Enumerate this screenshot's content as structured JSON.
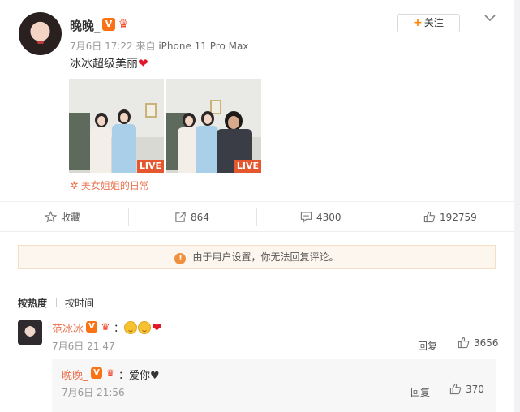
{
  "post": {
    "author": "晚晚_",
    "date": "7月6日 17:22",
    "source_prefix": "来自",
    "device": "iPhone 11 Pro Max",
    "follow_label": "关注",
    "text": "冰冰超级美丽",
    "photos": [
      {
        "tag": "LIVE"
      },
      {
        "tag": "LIVE"
      }
    ],
    "topic": "美女姐姐的日常"
  },
  "actions": {
    "favorite_label": "收藏",
    "share_count": "864",
    "comment_count": "4300",
    "like_count": "192759"
  },
  "notice": {
    "text": "由于用户设置，你无法回复评论。"
  },
  "sort": {
    "by_heat": "按热度",
    "by_time": "按时间"
  },
  "comments": [
    {
      "name": "范冰冰",
      "time": "7月6日 21:47",
      "reply_label": "回复",
      "likes": "3656",
      "replies": [
        {
          "name": "晚晚_",
          "text": "爱你♥",
          "time": "7月6日 21:56",
          "reply_label": "回复",
          "likes": "370"
        }
      ]
    }
  ],
  "colors": {
    "accent": "#eb7350",
    "follow_plus": "#ff8200",
    "live_tag": "#e5572e",
    "notice_bg": "#fdf6ee",
    "notice_icon": "#f0903e",
    "heart": "#e0182a"
  },
  "icons": {
    "favorite": "star-outline-icon",
    "share": "share-arrow-icon",
    "comment": "comment-bubble-icon",
    "like": "thumbs-up-icon",
    "more": "chevron-down-icon",
    "notice": "warning-circle-icon",
    "topic": "snowflake-icon"
  }
}
